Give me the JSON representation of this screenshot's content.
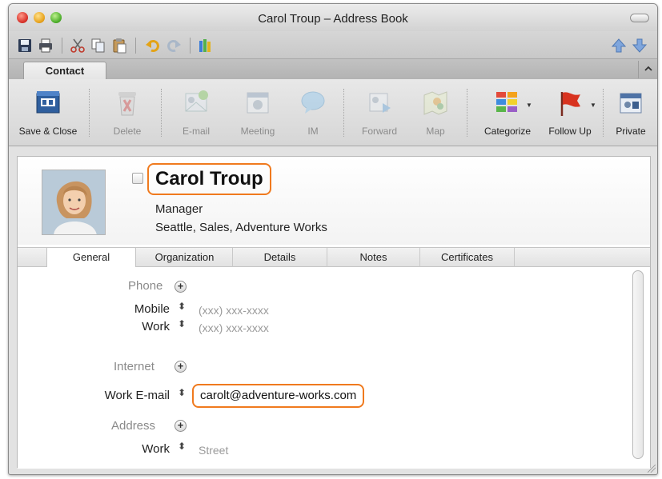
{
  "window": {
    "title": "Carol Troup – Address Book"
  },
  "ribbon_tab": {
    "label": "Contact",
    "collapse_icon": "chevron-up-icon"
  },
  "ribbon": {
    "buttons": [
      {
        "label": "Save & Close",
        "icon": "save-close-icon",
        "enabled": true
      },
      {
        "label": "Delete",
        "icon": "trash-icon",
        "enabled": false
      },
      {
        "label": "E-mail",
        "icon": "email-icon",
        "enabled": false
      },
      {
        "label": "Meeting",
        "icon": "calendar-icon",
        "enabled": false
      },
      {
        "label": "IM",
        "icon": "chat-bubble-icon",
        "enabled": false
      },
      {
        "label": "Forward",
        "icon": "forward-card-icon",
        "enabled": false
      },
      {
        "label": "Map",
        "icon": "map-icon",
        "enabled": false
      },
      {
        "label": "Categorize",
        "icon": "category-grid-icon",
        "enabled": true
      },
      {
        "label": "Follow Up",
        "icon": "flag-icon",
        "enabled": true
      },
      {
        "label": "Private",
        "icon": "private-icon",
        "enabled": true
      }
    ]
  },
  "contact": {
    "name": "Carol Troup",
    "job_title": "Manager",
    "location_department_company": "Seattle, Sales, Adventure Works"
  },
  "section_tabs": [
    "General",
    "Organization",
    "Details",
    "Notes",
    "Certificates"
  ],
  "general": {
    "phone": {
      "label": "Phone",
      "fields": [
        {
          "label": "Mobile",
          "value": "(xxx) xxx-xxxx"
        },
        {
          "label": "Work",
          "value": "(xxx) xxx-xxxx"
        }
      ]
    },
    "internet": {
      "label": "Internet",
      "fields": [
        {
          "label": "Work E-mail",
          "value": "carolt@adventure-works.com"
        }
      ]
    },
    "address": {
      "label": "Address",
      "fields": [
        {
          "label": "Work",
          "value": "Street"
        }
      ]
    },
    "plus_symbol": "+",
    "updown_symbol": "⬍"
  },
  "colors": {
    "highlight": "#f07a1e",
    "muted_text": "#9a9a9a"
  }
}
